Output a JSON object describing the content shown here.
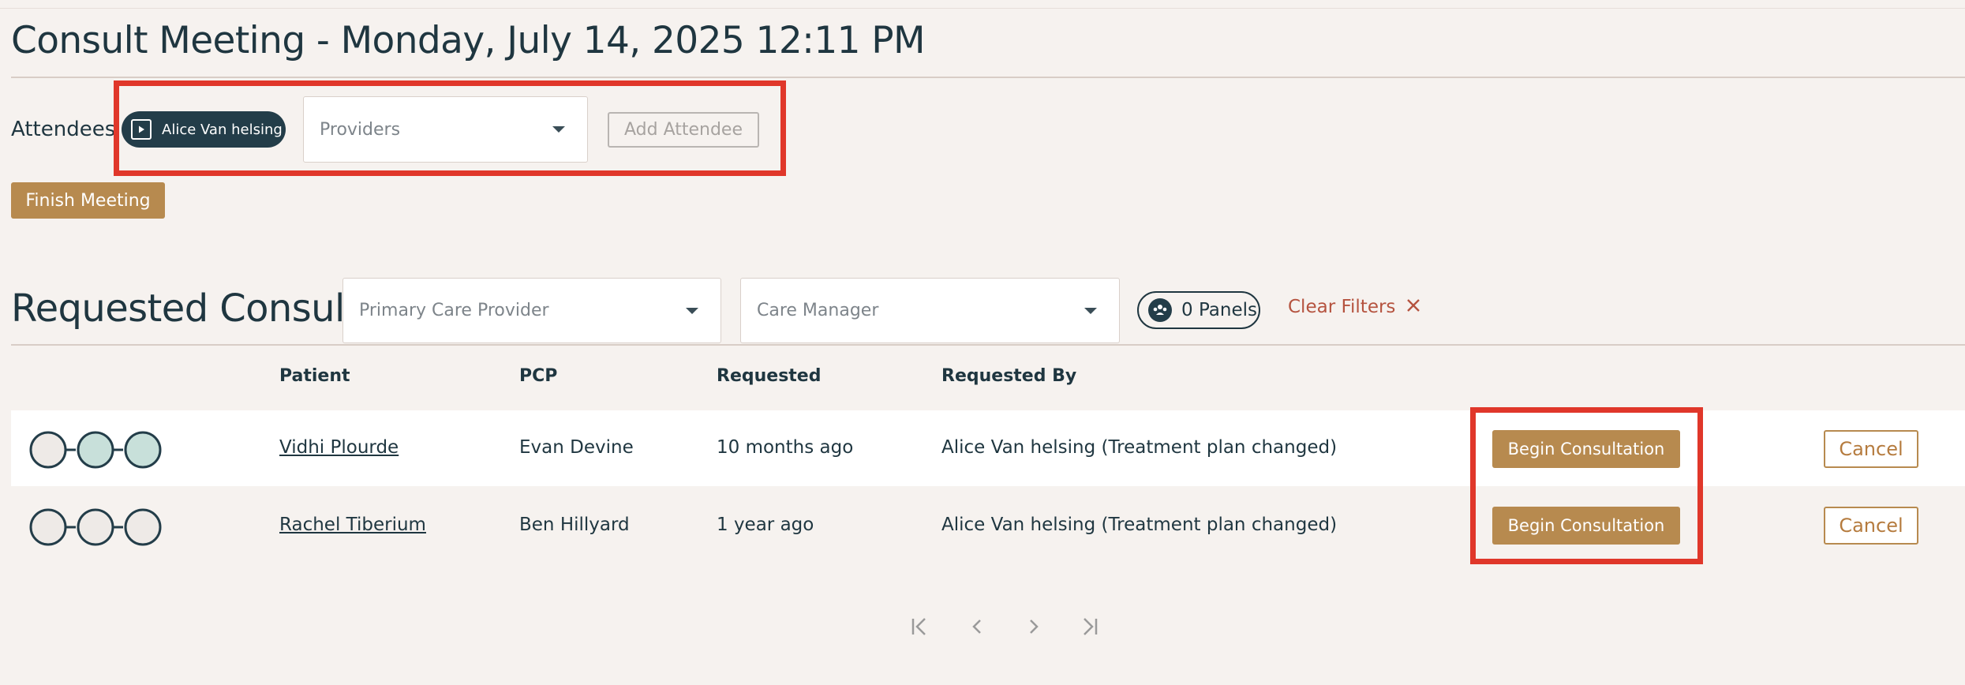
{
  "header": {
    "title": "Consult Meeting - Monday, July 14, 2025 12:11 PM"
  },
  "attendees": {
    "label": "Attendees",
    "chip_label": "Alice Van helsing",
    "providers_placeholder": "Providers",
    "add_button": "Add Attendee"
  },
  "finish_button": "Finish Meeting",
  "consults": {
    "title": "Requested Consults",
    "filters": {
      "pcp_placeholder": "Primary Care Provider",
      "care_manager_placeholder": "Care Manager",
      "panels_label": "0 Panels",
      "clear_label": "Clear Filters"
    },
    "columns": [
      "Patient",
      "PCP",
      "Requested",
      "Requested By"
    ],
    "rows": [
      {
        "patient": "Vidhi Plourde",
        "pcp": "Evan Devine",
        "requested": "10 months ago",
        "requested_by": "Alice Van helsing (Treatment plan changed)",
        "begin_label": "Begin Consultation",
        "cancel_label": "Cancel",
        "status_filled": [
          false,
          true,
          true
        ]
      },
      {
        "patient": "Rachel Tiberium",
        "pcp": "Ben Hillyard",
        "requested": "1 year ago",
        "requested_by": "Alice Van helsing (Treatment plan changed)",
        "begin_label": "Begin Consultation",
        "cancel_label": "Cancel",
        "status_filled": [
          false,
          false,
          false
        ]
      }
    ]
  },
  "colors": {
    "accent_gold": "#b78a4f",
    "dark_navy": "#233d49",
    "highlight_red": "#e0372a",
    "filled_circle": "#c8e0da",
    "empty_circle": "#eeeae7"
  },
  "icons": {
    "chip": "play-square-icon",
    "caret": "caret-down-icon",
    "panels": "people-group-icon",
    "clear": "close-icon",
    "pager": [
      "first-page-icon",
      "prev-page-icon",
      "next-page-icon",
      "last-page-icon"
    ]
  }
}
